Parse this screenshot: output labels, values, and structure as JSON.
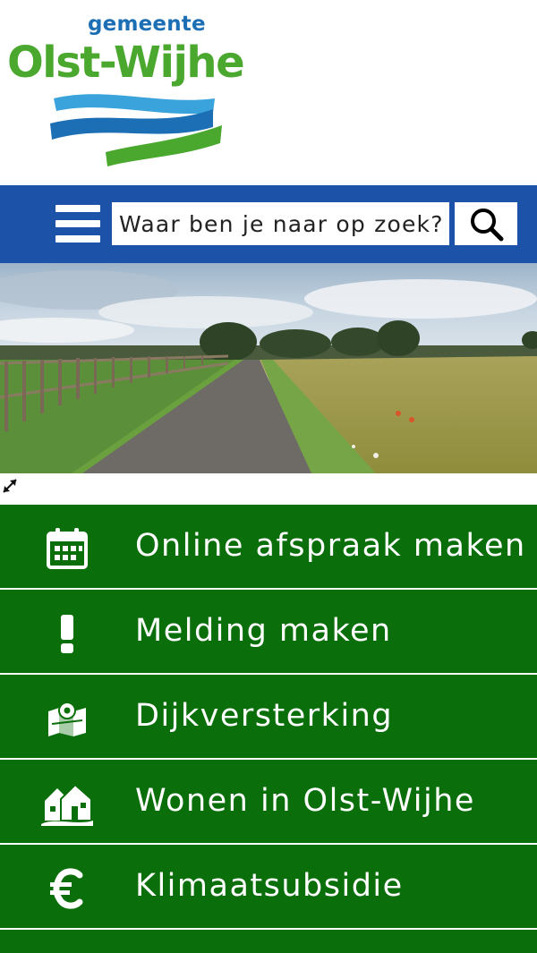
{
  "logo": {
    "small_text": "gemeente",
    "main_text": "Olst-Wijhe",
    "colors": {
      "small": "#1c6fb4",
      "main": "#4aa82e",
      "wave_light": "#3aa3dc",
      "wave_dark": "#1c6fb4",
      "wave_green": "#4aa82e"
    }
  },
  "navbar": {
    "background": "#1c52a8",
    "menu_icon": "hamburger-menu-icon",
    "search_placeholder": "Waar ben je naar op zoek?",
    "search_icon": "search-icon"
  },
  "hero": {
    "alt": "Landweg tussen weiland en graanveld",
    "expand_icon": "expand-icon"
  },
  "quicklinks": {
    "background": "#0a6e0a",
    "items": [
      {
        "label": "Online afspraak maken",
        "icon": "calendar-icon"
      },
      {
        "label": "Melding maken",
        "icon": "exclamation-icon"
      },
      {
        "label": "Dijkversterking",
        "icon": "map-pin-icon"
      },
      {
        "label": "Wonen in Olst-Wijhe",
        "icon": "houses-icon"
      },
      {
        "label": "Klimaatsubsidie",
        "icon": "euro-icon"
      }
    ]
  }
}
